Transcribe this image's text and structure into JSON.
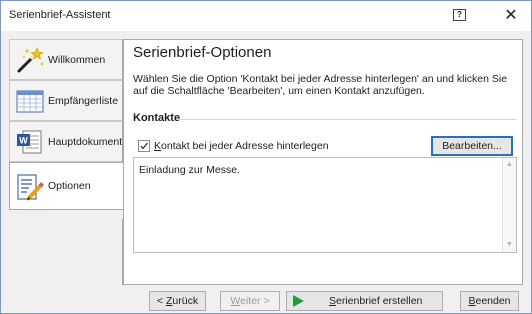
{
  "window": {
    "title": "Serienbrief-Assistent",
    "help_glyph": "?",
    "close_glyph": "✕"
  },
  "tabs": [
    {
      "label": "Willkommen",
      "icon": "magic-wand-icon"
    },
    {
      "label": "Empfängerliste",
      "icon": "table-list-icon"
    },
    {
      "label": "Hauptdokument",
      "icon": "word-document-icon"
    },
    {
      "label": "Optionen",
      "icon": "document-pencil-icon",
      "active": true
    }
  ],
  "page": {
    "heading": "Serienbrief-Optionen",
    "description": "Wählen Sie die Option 'Kontakt bei jeder Adresse hinterlegen' an und klicken Sie auf die Schaltfläche 'Bearbeiten', um einen Kontakt anzufügen.",
    "section_title": "Kontakte",
    "checkbox_label_hot": "K",
    "checkbox_label_rest": "ontakt bei jeder Adresse hinterlegen",
    "checkbox_checked": true,
    "edit_button": "Bearbeiten...",
    "textarea_value": "Einladung zur Messe."
  },
  "footer": {
    "back_hot": "Z",
    "back_prefix": "< ",
    "back_rest": "urück",
    "next_hot": "W",
    "next_rest": "eiter >",
    "create_hot": "S",
    "create_rest": "erienbrief erstellen",
    "finish_hot": "B",
    "finish_rest": "eenden"
  },
  "colors": {
    "accent": "#2a6fbf",
    "create_icon": "#1f9e36"
  }
}
